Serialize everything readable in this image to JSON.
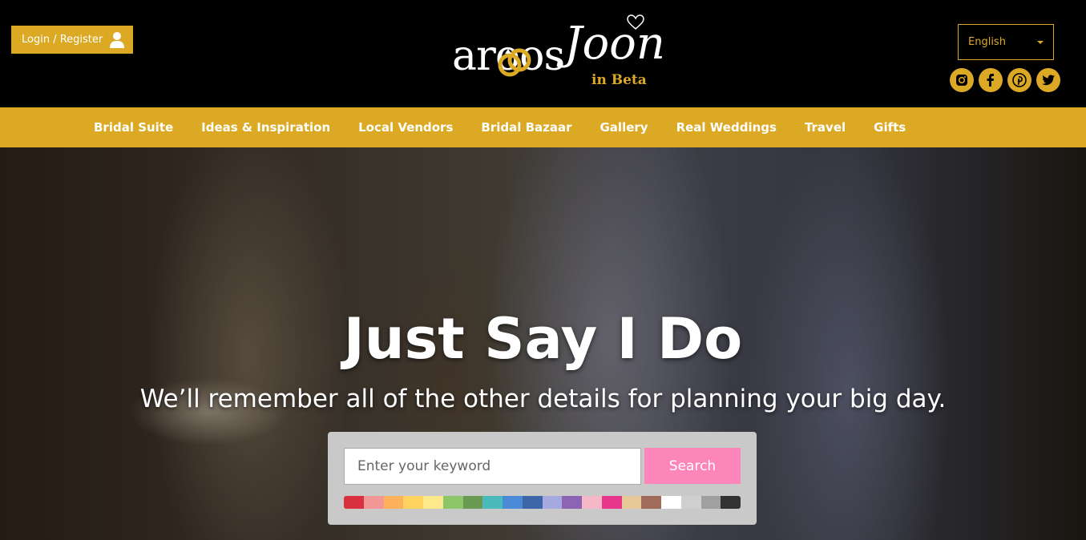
{
  "header": {
    "login_label": "Login / Register",
    "logo_text": "aroos",
    "logo_script": "Joon",
    "logo_beta": "in Beta",
    "language": "English",
    "social": [
      "instagram-icon",
      "facebook-icon",
      "pinterest-icon",
      "twitter-icon"
    ]
  },
  "nav": {
    "items": [
      "Bridal Suite",
      "Ideas & Inspiration",
      "Local Vendors",
      "Bridal Bazaar",
      "Gallery",
      "Real Weddings",
      "Travel",
      "Gifts"
    ]
  },
  "hero": {
    "title": "Just Say I Do",
    "subtitle": "We’ll remember all of the other details for planning your big day."
  },
  "search": {
    "placeholder": "Enter your keyword",
    "button_label": "Search",
    "swatches": [
      "#d9303f",
      "#f39696",
      "#fdb15a",
      "#fed35f",
      "#fde98b",
      "#8cc56a",
      "#6a9a52",
      "#4bbabc",
      "#4b8ad6",
      "#3d66a8",
      "#a6a8e0",
      "#8d63b3",
      "#f5b8c6",
      "#e6358b",
      "#e8c99a",
      "#a06b58",
      "#ffffff",
      "#cfcfcf",
      "#a0a0a0",
      "#333333"
    ]
  },
  "colors": {
    "brand_gold": "#dba923",
    "search_pink": "#fc85b9"
  }
}
